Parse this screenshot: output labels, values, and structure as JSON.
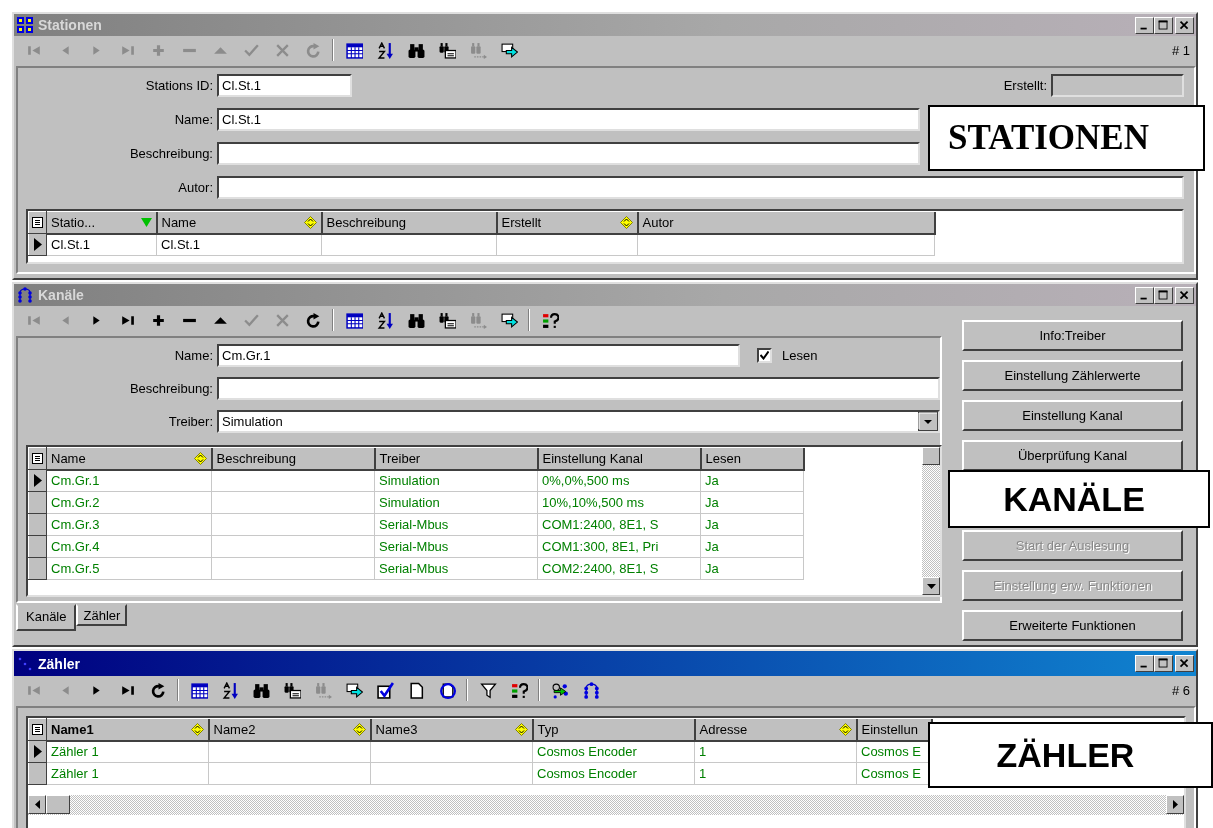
{
  "stationen": {
    "title": "Stationen",
    "active": false,
    "record": "# 1",
    "toolbar": [
      {
        "kind": "first",
        "disabled": true
      },
      {
        "kind": "prev",
        "disabled": true
      },
      {
        "kind": "next",
        "disabled": true
      },
      {
        "kind": "last",
        "disabled": true
      },
      {
        "kind": "add",
        "disabled": true
      },
      {
        "kind": "delete",
        "disabled": true
      },
      {
        "kind": "up",
        "disabled": true
      },
      {
        "kind": "post",
        "disabled": true
      },
      {
        "kind": "cancel",
        "disabled": true
      },
      {
        "kind": "refresh",
        "disabled": true
      },
      {
        "kind": "separator"
      },
      {
        "kind": "grid",
        "disabled": false
      },
      {
        "kind": "sort",
        "disabled": false
      },
      {
        "kind": "find",
        "disabled": false
      },
      {
        "kind": "findfield",
        "disabled": false
      },
      {
        "kind": "findnext",
        "disabled": true
      },
      {
        "kind": "goto",
        "disabled": false
      }
    ],
    "fields": [
      {
        "label": "Stations ID:",
        "value": "Cl.St.1",
        "disabled": false
      },
      {
        "label": "Erstellt:",
        "disabled": true
      },
      {
        "label": "Name:",
        "value": "Cl.St.1",
        "disabled": false
      },
      {
        "label": "Beschreibung:",
        "disabled": false
      },
      {
        "label": "Autor:",
        "disabled": false
      }
    ],
    "grid": {
      "columns": [
        {
          "label": "Statio...",
          "sorted": true,
          "sortable": false,
          "bold": false
        },
        {
          "label": "Name",
          "sorted": false,
          "sortable": true,
          "bold": false
        },
        {
          "label": "Beschreibung",
          "sorted": false,
          "sortable": false,
          "bold": false
        },
        {
          "label": "Erstellt",
          "sorted": false,
          "sortable": true,
          "bold": false
        },
        {
          "label": "Autor",
          "sorted": false,
          "sortable": false,
          "bold": false
        }
      ],
      "rows": [
        {
          "selected": true,
          "cells": [
            "Cl.St.1",
            "Cl.St.1",
            null,
            null,
            null
          ]
        }
      ]
    }
  },
  "kanaele": {
    "title": "Kanäle",
    "active": false,
    "toolbar": [
      {
        "kind": "first",
        "disabled": true
      },
      {
        "kind": "prev",
        "disabled": true
      },
      {
        "kind": "next",
        "disabled": false
      },
      {
        "kind": "last",
        "disabled": false
      },
      {
        "kind": "add",
        "disabled": false
      },
      {
        "kind": "delete",
        "disabled": false
      },
      {
        "kind": "up",
        "disabled": false
      },
      {
        "kind": "post",
        "disabled": true
      },
      {
        "kind": "cancel",
        "disabled": true
      },
      {
        "kind": "refresh",
        "disabled": false
      },
      {
        "kind": "separator"
      },
      {
        "kind": "grid",
        "disabled": false
      },
      {
        "kind": "sort",
        "disabled": false
      },
      {
        "kind": "find",
        "disabled": false
      },
      {
        "kind": "findfield",
        "disabled": false
      },
      {
        "kind": "findnext",
        "disabled": true
      },
      {
        "kind": "goto",
        "disabled": false
      },
      {
        "kind": "separator"
      },
      {
        "kind": "help",
        "disabled": false
      }
    ],
    "fields": [
      {
        "label": "Name:",
        "value": "Cm.Gr.1",
        "kind": "text"
      },
      {
        "label": "Beschreibung:",
        "kind": "text"
      },
      {
        "label": "Treiber:",
        "value": "Simulation",
        "kind": "combo"
      }
    ],
    "checkbox": {
      "label": "Lesen",
      "checked": true
    },
    "grid": {
      "columns": [
        {
          "label": "Name",
          "sorted": false,
          "sortable": true,
          "bold": false
        },
        {
          "label": "Beschreibung",
          "sorted": false,
          "sortable": false,
          "bold": false
        },
        {
          "label": "Treiber",
          "sorted": false,
          "sortable": false,
          "bold": false
        },
        {
          "label": "Einstellung Kanal",
          "sorted": false,
          "sortable": false,
          "bold": false
        },
        {
          "label": "Lesen",
          "sorted": false,
          "sortable": false,
          "bold": false
        }
      ],
      "rows": [
        {
          "selected": true,
          "cells": [
            "Cm.Gr.1",
            null,
            "Simulation",
            "0%,0%,500 ms",
            "Ja"
          ]
        },
        {
          "selected": false,
          "cells": [
            "Cm.Gr.2",
            null,
            "Simulation",
            "10%,10%,500 ms",
            "Ja"
          ]
        },
        {
          "selected": false,
          "cells": [
            "Cm.Gr.3",
            null,
            "Serial-Mbus",
            "COM1:2400, 8E1, S",
            "Ja"
          ]
        },
        {
          "selected": false,
          "cells": [
            "Cm.Gr.4",
            null,
            "Serial-Mbus",
            "COM1:300, 8E1, Pri",
            "Ja"
          ]
        },
        {
          "selected": false,
          "cells": [
            "Cm.Gr.5",
            null,
            "Serial-Mbus",
            "COM2:2400, 8E1, S",
            "Ja"
          ]
        }
      ]
    },
    "tabs": [
      {
        "label": "Kanäle",
        "selected": true
      },
      {
        "label": "Zähler",
        "selected": false
      }
    ],
    "buttons": [
      {
        "label": "Info:Treiber",
        "disabled": false
      },
      {
        "label": "Einstellung Zählerwerte",
        "disabled": false
      },
      {
        "label": "Einstellung Kanal",
        "disabled": false
      },
      {
        "label": "Überprüfung Kanal",
        "disabled": false
      },
      {
        "label": "Start der Auslesung",
        "disabled": true
      },
      {
        "label": "Einstellung erw. Funktionen",
        "disabled": true
      },
      {
        "label": "Erweiterte Funktionen",
        "disabled": false
      }
    ]
  },
  "zaehler": {
    "title": "Zähler",
    "active": true,
    "record": "# 6",
    "toolbar": [
      {
        "kind": "first",
        "disabled": true
      },
      {
        "kind": "prev",
        "disabled": true
      },
      {
        "kind": "next",
        "disabled": false
      },
      {
        "kind": "last",
        "disabled": false
      },
      {
        "kind": "refresh",
        "disabled": false
      },
      {
        "kind": "separator"
      },
      {
        "kind": "grid",
        "disabled": false
      },
      {
        "kind": "sort",
        "disabled": false
      },
      {
        "kind": "find",
        "disabled": false
      },
      {
        "kind": "findfield",
        "disabled": false
      },
      {
        "kind": "findnext",
        "disabled": true
      },
      {
        "kind": "goto",
        "disabled": false
      },
      {
        "kind": "check",
        "disabled": false
      },
      {
        "kind": "page",
        "disabled": false
      },
      {
        "kind": "pagerefresh",
        "disabled": false
      },
      {
        "kind": "separator"
      },
      {
        "kind": "filter",
        "disabled": false
      },
      {
        "kind": "help",
        "disabled": false
      },
      {
        "kind": "separator"
      },
      {
        "kind": "import",
        "disabled": false
      },
      {
        "kind": "channels",
        "disabled": false
      }
    ],
    "grid": {
      "columns": [
        {
          "label": "Name1",
          "sorted": false,
          "sortable": true,
          "bold": true
        },
        {
          "label": "Name2",
          "sorted": false,
          "sortable": true,
          "bold": false
        },
        {
          "label": "Name3",
          "sorted": false,
          "sortable": true,
          "bold": false
        },
        {
          "label": "Typ",
          "sorted": false,
          "sortable": false,
          "bold": false
        },
        {
          "label": "Adresse",
          "sorted": false,
          "sortable": true,
          "bold": false
        },
        {
          "label": "Einstellun",
          "sorted": false,
          "sortable": false,
          "bold": false
        }
      ],
      "rows": [
        {
          "selected": true,
          "cells": [
            "Zähler 1",
            null,
            null,
            "Cosmos Encoder",
            "1",
            "Cosmos E"
          ]
        },
        {
          "selected": false,
          "cells": [
            "Zähler 1",
            null,
            null,
            "Cosmos Encoder",
            "1",
            "Cosmos E"
          ]
        }
      ]
    }
  },
  "callouts": [
    {
      "text": "STATIONEN",
      "kind": "serif"
    },
    {
      "text": "KANÄLE",
      "kind": "sans"
    },
    {
      "text": "ZÄHLER",
      "kind": "sans"
    }
  ]
}
